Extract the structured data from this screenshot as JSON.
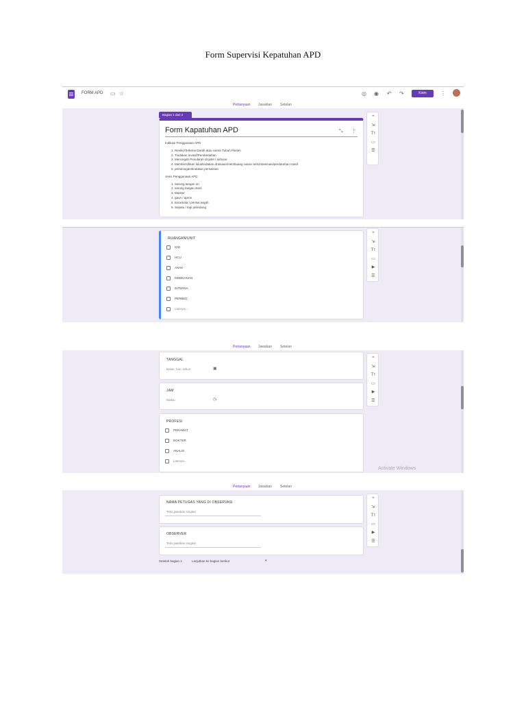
{
  "document_title": "Form Supervisi Kepatuhan APD",
  "appbar": {
    "app_name": "FORM APD",
    "send_label": "Kirim",
    "icons": [
      "palette-icon",
      "eye-icon",
      "undo-icon",
      "redo-icon",
      "more-icon"
    ]
  },
  "tabs": [
    "Pertanyaan",
    "Jawaban",
    "Setelan"
  ],
  "toolbar_icons": [
    "+",
    "⇲",
    "Tт",
    "▭",
    "▶",
    "☰"
  ],
  "section1": {
    "badge": "Bagian 1 dari 2",
    "title": "Form Kapatuhan APD",
    "indication_heading": "Indikasi Penggunaan APD",
    "indications": [
      "Resiko/Terkena Darah atau cairan Tubuh Pasien",
      "Tindakan Invasif/Pembedahan",
      "Mencegah Penularan droplet / airbone",
      "Membersihkan luka/tindakan drainase/membuang cairan terkontaminasi/perdarahan masif",
      "pertolongan/tindakan persalinan"
    ],
    "type_heading": "Jenis Penggunaan APD",
    "types": [
      "Sarung tangan on",
      "sarung tangan steril",
      "Masker",
      "gaun / apron",
      "kacamata / pensai wajah",
      "Sepatu / topi pelindung"
    ]
  },
  "ruangan": {
    "title": "RUANGAN/UNIT",
    "options": [
      "IGD",
      "HCU",
      "ANAK",
      "KEBIDANAN",
      "INTERNA",
      "PERBED"
    ],
    "other": "Lainnya..."
  },
  "tanggal": {
    "title": "TANGGAL",
    "hint": "Bulan, hari, tahun"
  },
  "jam": {
    "title": "JAM",
    "hint": "Waktu"
  },
  "profesi": {
    "title": "PROFESI",
    "options": [
      "PERAWAT",
      "DOKTER",
      "ANALIS"
    ],
    "other": "Lainnya..."
  },
  "petugas": {
    "title": "NAMA PETUGAS YANG DI OBSERVASI",
    "hint": "Teks jawaban singkat"
  },
  "observer": {
    "title": "OBSERVER",
    "hint": "Teks jawaban singkat"
  },
  "after_section": {
    "label": "Setelah bagian 1",
    "value": "Lanjutkan ke bagian berikut"
  },
  "watermark": "Activate Windows"
}
